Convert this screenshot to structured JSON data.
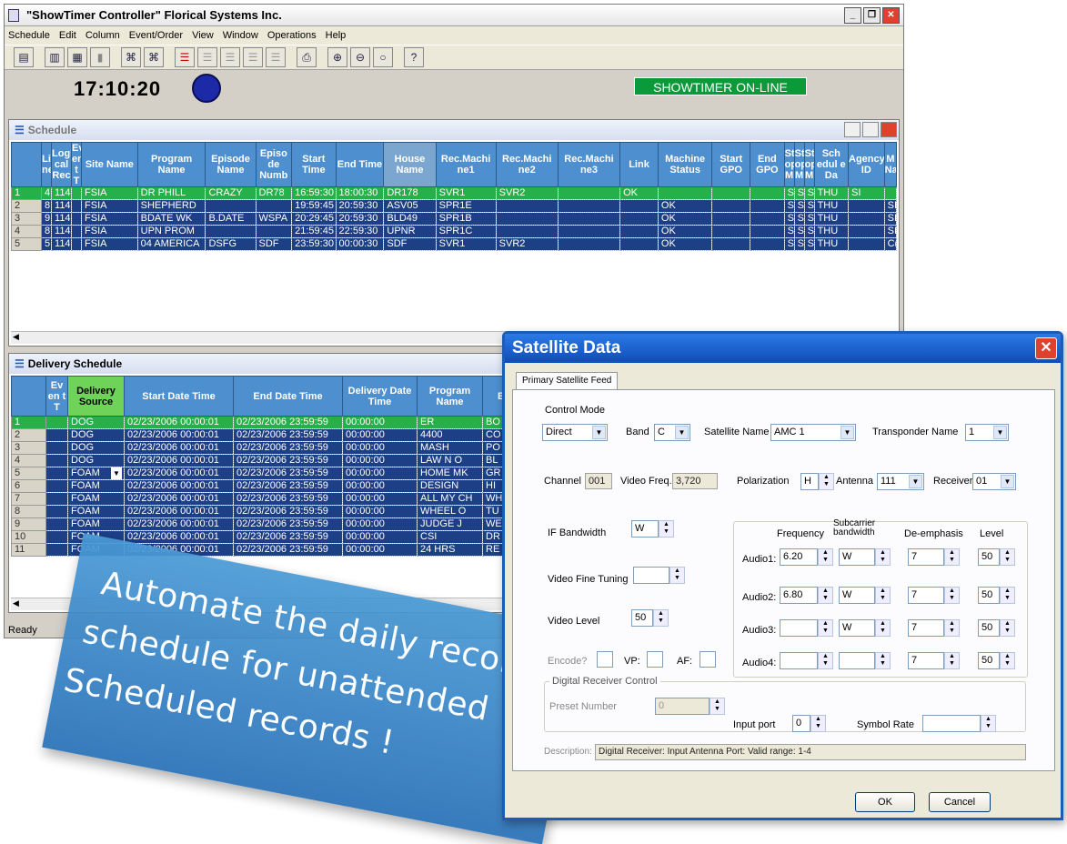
{
  "app": {
    "title": "\"ShowTimer Controller\" Florical Systems Inc.",
    "menu": [
      "Schedule",
      "Edit",
      "Column",
      "Event/Order",
      "View",
      "Window",
      "Operations",
      "Help"
    ],
    "clock": "17:10:20",
    "status_label": "SHOWTIMER ON-LINE",
    "status_bar": "Ready"
  },
  "schedule": {
    "title": "Schedule",
    "headers": [
      "Li ne",
      "Logi cal Rec",
      "Ev en t T",
      "Site Name",
      "Program Name",
      "Episode Name",
      "Episo de Numb",
      "Start Time",
      "End Time",
      "House Name",
      "Rec.Machi ne1",
      "Rec.Machi ne2",
      "Rec.Machi ne3",
      "Link",
      "Machine Status",
      "Start GPO",
      "End GPO",
      "St op M",
      "St op M",
      "St op M",
      "Sch edul e Da",
      "Agency ID",
      "M Na"
    ],
    "rows": [
      {
        "n": "1",
        "c": [
          "4",
          "114",
          "",
          "FSIA",
          "DR PHILL",
          "CRAZY",
          "DR78",
          "16:59:30",
          "18:00:30",
          "DR178",
          "SVR1",
          "SVR2",
          "",
          "OK",
          "",
          "",
          "",
          "S",
          "S",
          "S",
          "THU",
          "SI",
          ""
        ]
      },
      {
        "n": "2",
        "c": [
          "8",
          "114",
          "",
          "FSIA",
          "SHEPHERD",
          "",
          "",
          "19:59:45",
          "20:59:30",
          "ASV05",
          "SPR1E",
          "",
          "",
          "",
          "OK",
          "",
          "",
          "S",
          "S",
          "S",
          "THU",
          "",
          "SI"
        ]
      },
      {
        "n": "3",
        "c": [
          "9",
          "114",
          "",
          "FSIA",
          "BDATE WK",
          "B.DATE",
          "WSPA",
          "20:29:45",
          "20:59:30",
          "BLD49",
          "SPR1B",
          "",
          "",
          "",
          "OK",
          "",
          "",
          "S",
          "S",
          "S",
          "THU",
          "",
          "SI"
        ]
      },
      {
        "n": "4",
        "c": [
          "8",
          "114",
          "",
          "FSIA",
          "UPN PROM",
          "",
          "",
          "21:59:45",
          "22:59:30",
          "UPNR",
          "SPR1C",
          "",
          "",
          "",
          "OK",
          "",
          "",
          "S",
          "S",
          "S",
          "THU",
          "",
          "SI"
        ]
      },
      {
        "n": "5",
        "c": [
          "5",
          "114",
          "",
          "FSIA",
          "04 AMERICA",
          "DSFG",
          "SDF",
          "23:59:30",
          "00:00:30",
          "SDF",
          "SVR1",
          "SVR2",
          "",
          "",
          "OK",
          "",
          "",
          "S",
          "S",
          "S",
          "THU",
          "",
          "C("
        ]
      }
    ]
  },
  "delivery": {
    "title": "Delivery Schedule",
    "headers": [
      "Ev en t T",
      "Delivery Source",
      "Start Date Time",
      "End Date Time",
      "Delivery Date Time",
      "Program Name",
      "Ep N"
    ],
    "rows": [
      {
        "n": "1",
        "c": [
          "",
          "DOG",
          "02/23/2006 00:00:01",
          "02/23/2006 23:59:59",
          "00:00:00",
          "ER",
          "BO"
        ]
      },
      {
        "n": "2",
        "c": [
          "",
          "DOG",
          "02/23/2006 00:00:01",
          "02/23/2006 23:59:59",
          "00:00:00",
          "4400",
          "CO"
        ]
      },
      {
        "n": "3",
        "c": [
          "",
          "DOG",
          "02/23/2006 00:00:01",
          "02/23/2006 23:59:59",
          "00:00:00",
          "MASH",
          "PO"
        ]
      },
      {
        "n": "4",
        "c": [
          "",
          "DOG",
          "02/23/2006 00:00:01",
          "02/23/2006 23:59:59",
          "00:00:00",
          "LAW N O",
          "BL"
        ]
      },
      {
        "n": "5",
        "c": [
          "",
          "FOAM",
          "02/23/2006 00:00:01",
          "02/23/2006 23:59:59",
          "00:00:00",
          "HOME MK",
          "GR"
        ]
      },
      {
        "n": "6",
        "c": [
          "",
          "FOAM",
          "02/23/2006 00:00:01",
          "02/23/2006 23:59:59",
          "00:00:00",
          "DESIGN",
          "HI"
        ]
      },
      {
        "n": "7",
        "c": [
          "",
          "FOAM",
          "02/23/2006 00:00:01",
          "02/23/2006 23:59:59",
          "00:00:00",
          "ALL MY CH",
          "WH"
        ]
      },
      {
        "n": "8",
        "c": [
          "",
          "FOAM",
          "02/23/2006 00:00:01",
          "02/23/2006 23:59:59",
          "00:00:00",
          "WHEEL O",
          "TU"
        ]
      },
      {
        "n": "9",
        "c": [
          "",
          "FOAM",
          "02/23/2006 00:00:01",
          "02/23/2006 23:59:59",
          "00:00:00",
          "JUDGE J",
          "WE"
        ]
      },
      {
        "n": "10",
        "c": [
          "",
          "FOAM",
          "02/23/2006 00:00:01",
          "02/23/2006 23:59:59",
          "00:00:00",
          "CSI",
          "DR"
        ]
      },
      {
        "n": "11",
        "c": [
          "",
          "FOAM",
          "02/23/2006 00:00:01",
          "02/23/2006 23:59:59",
          "00:00:00",
          "24 HRS",
          "RE"
        ]
      }
    ]
  },
  "satellite": {
    "title": "Satellite Data",
    "tab": "Primary Satellite Feed",
    "control_mode_label": "Control Mode",
    "control_mode": "Direct",
    "band_label": "Band",
    "band": "C",
    "satellite_name_label": "Satellite Name",
    "satellite_name": "AMC 1",
    "transponder_label": "Transponder Name",
    "transponder": "1",
    "channel_label": "Channel",
    "channel": "001",
    "video_freq_label": "Video Freq.",
    "video_freq": "3,720",
    "polarization_label": "Polarization",
    "polarization": "H",
    "antenna_label": "Antenna",
    "antenna": "111",
    "receiver_label": "Receiver",
    "receiver": "01",
    "if_bandwidth_label": "IF Bandwidth",
    "if_bandwidth": "W",
    "video_fine_tuning_label": "Video Fine Tuning",
    "video_level_label": "Video Level",
    "video_level": "50",
    "encode_label": "Encode?",
    "vp_label": "VP:",
    "af_label": "AF:",
    "audio_headers": [
      "Frequency",
      "Subcarrier bandwidth",
      "De-emphasis",
      "Level"
    ],
    "audio_rows": [
      {
        "label": "Audio1:",
        "freq": "6.20",
        "bw": "W",
        "de": "7",
        "level": "50"
      },
      {
        "label": "Audio2:",
        "freq": "6.80",
        "bw": "W",
        "de": "7",
        "level": "50"
      },
      {
        "label": "Audio3:",
        "freq": "",
        "bw": "W",
        "de": "7",
        "level": "50"
      },
      {
        "label": "Audio4:",
        "freq": "",
        "bw": "",
        "de": "7",
        "level": "50"
      }
    ],
    "digital_group": "Digital Receiver Control",
    "preset_label": "Preset Number",
    "preset": "0",
    "input_port_label": "Input port",
    "input_port": "0",
    "symbol_rate_label": "Symbol Rate",
    "description_label": "Description:",
    "description": "Digital Receiver: Input Antenna Port: Valid range: 1-4",
    "ok": "OK",
    "cancel": "Cancel"
  },
  "banner": {
    "line1": "Automate the daily record",
    "line2": "schedule for unattended",
    "line3": "Scheduled records !"
  }
}
